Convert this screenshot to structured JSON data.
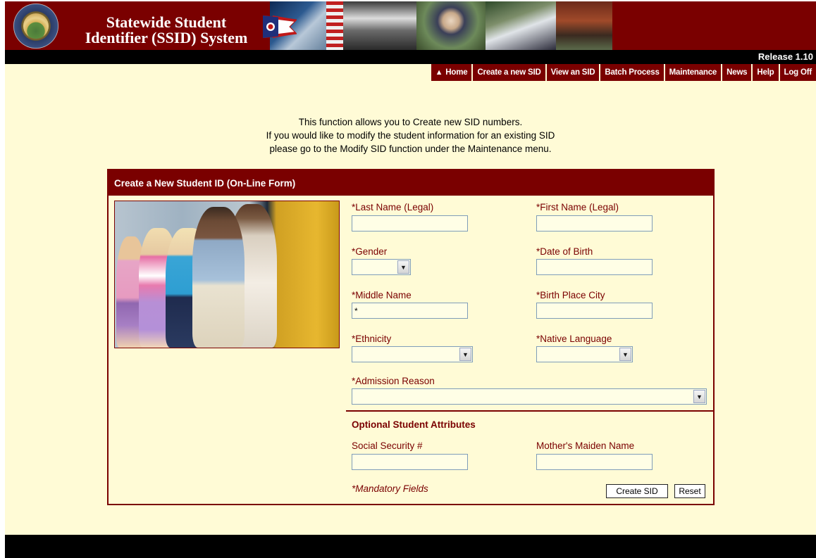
{
  "header": {
    "title_line1": "Statewide Student",
    "title_line2": "Identifier (SSID) System",
    "release": "Release 1.10"
  },
  "nav": [
    {
      "label": "Home",
      "icon": "home-icon"
    },
    {
      "label": "Create a new SID"
    },
    {
      "label": "View an SID"
    },
    {
      "label": "Batch Process"
    },
    {
      "label": "Maintenance"
    },
    {
      "label": "News"
    },
    {
      "label": "Help"
    },
    {
      "label": "Log Off"
    }
  ],
  "intro": {
    "line1": "This function allows you to Create new SID numbers.",
    "line2": "If you would like to modify the student information for an existing SID",
    "line3": "please go to the Modify SID function under the Maintenance menu."
  },
  "form": {
    "title": "Create a New Student ID (On-Line Form)",
    "fields": {
      "last_name": {
        "label": "*Last Name (Legal)",
        "value": ""
      },
      "first_name": {
        "label": "*First Name (Legal)",
        "value": ""
      },
      "gender": {
        "label": "*Gender",
        "value": ""
      },
      "date_of_birth": {
        "label": "*Date of Birth",
        "value": ""
      },
      "middle_name": {
        "label": "*Middle Name",
        "value": "*"
      },
      "birth_place_city": {
        "label": "*Birth Place City",
        "value": ""
      },
      "ethnicity": {
        "label": "*Ethnicity",
        "value": ""
      },
      "native_language": {
        "label": "*Native Language",
        "value": ""
      },
      "admission_reason": {
        "label": "*Admission Reason",
        "value": ""
      }
    },
    "optional_heading": "Optional Student Attributes",
    "optional_fields": {
      "ssn": {
        "label": "Social Security #",
        "value": ""
      },
      "mothers_maiden_name": {
        "label": "Mother's Maiden Name",
        "value": ""
      }
    },
    "mandatory_note": "*Mandatory Fields",
    "buttons": {
      "create": "Create SID",
      "reset": "Reset"
    }
  },
  "colors": {
    "brand": "#7a0000",
    "background": "#fffbd6",
    "bars": "#000000"
  },
  "icons": {
    "select_arrow": "chevron-down-icon",
    "home": "home-icon"
  }
}
